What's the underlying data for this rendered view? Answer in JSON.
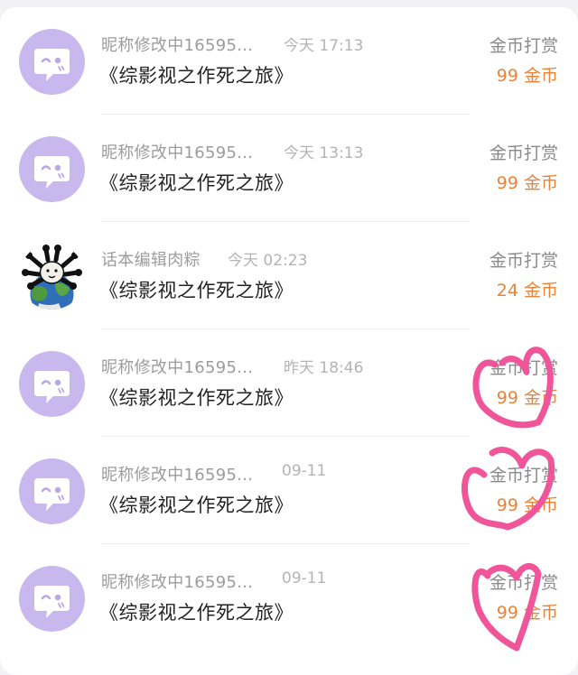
{
  "records": [
    {
      "nickname": "昵称修改中16595...",
      "time": "今天 17:13",
      "book_title": "《综影视之作死之旅》",
      "gift_label": "金币打赏",
      "amount": "99 金币",
      "avatar": "default-chat-bubble-icon"
    },
    {
      "nickname": "昵称修改中16595...",
      "time": "今天 13:13",
      "book_title": "《综影视之作死之旅》",
      "gift_label": "金币打赏",
      "amount": "99 金币",
      "avatar": "default-chat-bubble-icon"
    },
    {
      "nickname": "话本编辑肉粽",
      "time": "今天 02:23",
      "book_title": "《综影视之作死之旅》",
      "gift_label": "金币打赏",
      "amount": "24 金币",
      "avatar": "earth-bunny-avatar"
    },
    {
      "nickname": "昵称修改中16595...",
      "time": "昨天 18:46",
      "book_title": "《综影视之作死之旅》",
      "gift_label": "金币打赏",
      "amount": "99 金币",
      "avatar": "default-chat-bubble-icon"
    },
    {
      "nickname": "昵称修改中16595...",
      "time": "09-11",
      "book_title": "《综影视之作死之旅》",
      "gift_label": "金币打赏",
      "amount": "99 金币",
      "avatar": "default-chat-bubble-icon"
    },
    {
      "nickname": "昵称修改中16595...",
      "time": "09-11",
      "book_title": "《综影视之作死之旅》",
      "gift_label": "金币打赏",
      "amount": "99 金币",
      "avatar": "default-chat-bubble-icon"
    }
  ],
  "colors": {
    "avatar_bg": "#c9b8ee",
    "amount": "#e8833a",
    "annotation_heart": "#f0559a"
  },
  "annotations": [
    "heart-scribble",
    "heart-scribble",
    "heart-scribble"
  ]
}
